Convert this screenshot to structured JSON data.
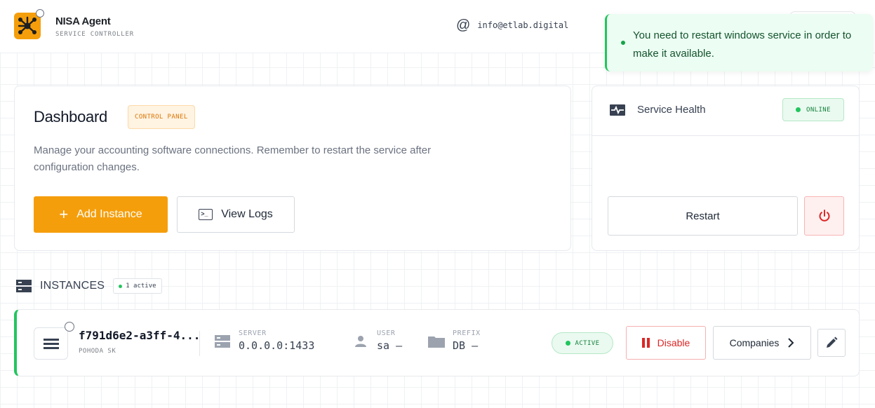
{
  "header": {
    "app_title": "NISA Agent",
    "app_subtitle": "SERVICE CONTROLLER",
    "email": "info@etlab.digital"
  },
  "toast": {
    "message": "You need to restart windows service in order to make it available."
  },
  "dashboard": {
    "title": "Dashboard",
    "badge": "CONTROL PANEL",
    "description": "Manage your accounting software connections. Remember to restart the service after configuration changes.",
    "add_button": "Add Instance",
    "logs_button": "View Logs"
  },
  "health": {
    "title": "Service Health",
    "status": "ONLINE",
    "restart_button": "Restart"
  },
  "instances": {
    "title": "INSTANCES",
    "active_count": "1 active",
    "rows": [
      {
        "id": "f791d6e2-a3ff-4...",
        "type": "POHODA SK",
        "server_label": "SERVER",
        "server": "0.0.0.0:1433",
        "user_label": "USER",
        "user": "sa —",
        "prefix_label": "PREFIX",
        "prefix": "DB —",
        "status": "ACTIVE",
        "disable_button": "Disable",
        "companies_button": "Companies"
      }
    ]
  },
  "colors": {
    "accent": "#f59e0b",
    "success": "#22c55e",
    "danger": "#dc2626"
  },
  "icons": {
    "logo": "network-hub-icon",
    "email": "at-icon",
    "health": "pulse-icon",
    "power": "power-icon",
    "instances": "server-stack-icon",
    "edit": "pencil-icon"
  }
}
